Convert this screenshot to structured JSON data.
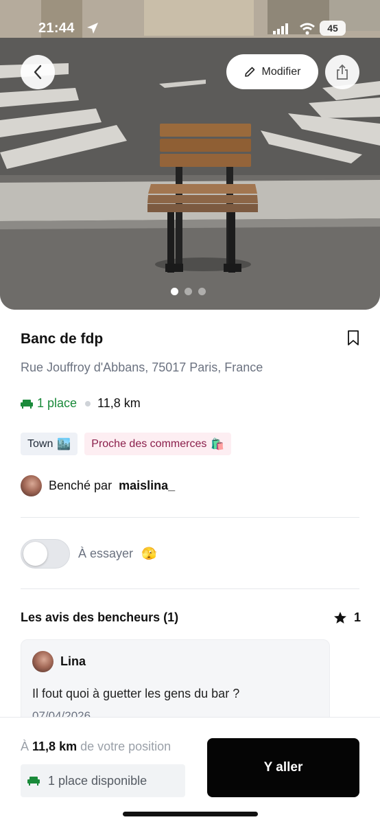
{
  "status_bar": {
    "time": "21:44",
    "battery": "45"
  },
  "hero": {
    "edit_label": "Modifier",
    "icons": {
      "back": "chevron-left-icon",
      "edit": "pencil-icon",
      "share": "share-icon"
    },
    "carousel": {
      "count": 3,
      "active": 1
    }
  },
  "bench": {
    "title": "Banc de fdp",
    "address": "Rue Jouffroy d'Abbans, 75017 Paris, France",
    "places": "1 place",
    "distance": "11,8 km",
    "tags": [
      {
        "label": "Town",
        "emoji": "🏙️"
      },
      {
        "label": "Proche des commerces",
        "emoji": "🛍️"
      }
    ],
    "author_prefix": "Benché par",
    "author": "maislina_"
  },
  "to_try": {
    "label": "À essayer",
    "emoji": "🫣",
    "enabled": false
  },
  "reviews": {
    "title": "Les avis des bencheurs (1)",
    "rating": "1",
    "items": [
      {
        "author": "Lina",
        "text": "Il fout quoi à guetter les gens du bar ?",
        "date": "07/04/2026"
      }
    ]
  },
  "bottom": {
    "where_prefix": "À",
    "where_value": "11,8 km",
    "where_suffix": "de votre position",
    "available": "1 place disponible",
    "go_label": "Y aller"
  },
  "colors": {
    "accent_green": "#1a8a3a",
    "tag_shops_text": "#8a1e4a",
    "primary_button": "#050505"
  }
}
